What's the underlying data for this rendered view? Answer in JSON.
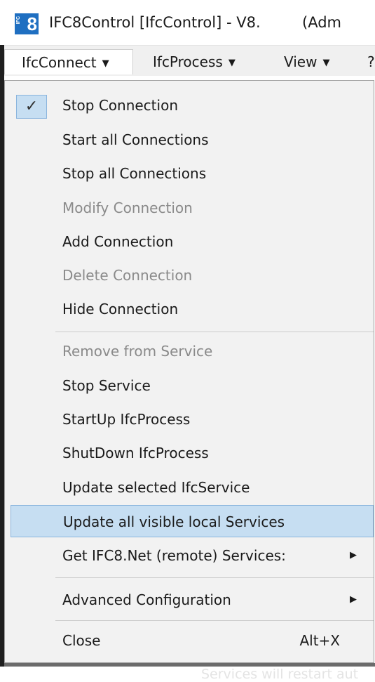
{
  "window": {
    "icon_label": "8",
    "icon_small": "IFC",
    "title": "IFC8Control [IfcControl] - V8.",
    "title_suffix": "(Adm"
  },
  "menubar": {
    "items": [
      {
        "label": "IfcConnect"
      },
      {
        "label": "IfcProcess"
      },
      {
        "label": "View"
      },
      {
        "label": "?"
      }
    ]
  },
  "dropdown": {
    "items": [
      {
        "label": "Stop Connection",
        "checked": true
      },
      {
        "label": "Start all Connections"
      },
      {
        "label": "Stop all Connections"
      },
      {
        "label": "Modify Connection",
        "disabled": true
      },
      {
        "label": "Add Connection"
      },
      {
        "label": "Delete Connection",
        "disabled": true
      },
      {
        "label": "Hide Connection"
      },
      {
        "label": "Remove from Service",
        "disabled": true
      },
      {
        "label": "Stop Service"
      },
      {
        "label": "StartUp IfcProcess"
      },
      {
        "label": "ShutDown IfcProcess"
      },
      {
        "label": "Update selected IfcService"
      },
      {
        "label": "Update all visible local Services",
        "highlighted": true
      },
      {
        "label": "Get IFC8.Net (remote) Services:",
        "submenu": true
      },
      {
        "label": "Advanced Configuration",
        "submenu": true
      },
      {
        "label": "Close",
        "shortcut": "Alt+X"
      }
    ],
    "check_glyph": "✓",
    "submenu_glyph": "▶"
  },
  "background_text": "Services will restart aut",
  "colors": {
    "highlight": "#c6def2",
    "highlight_border": "#8ab4dd",
    "menu_bg": "#f2f2f2",
    "disabled_text": "#8a8a8a",
    "icon_blue": "#1f6fc1"
  }
}
